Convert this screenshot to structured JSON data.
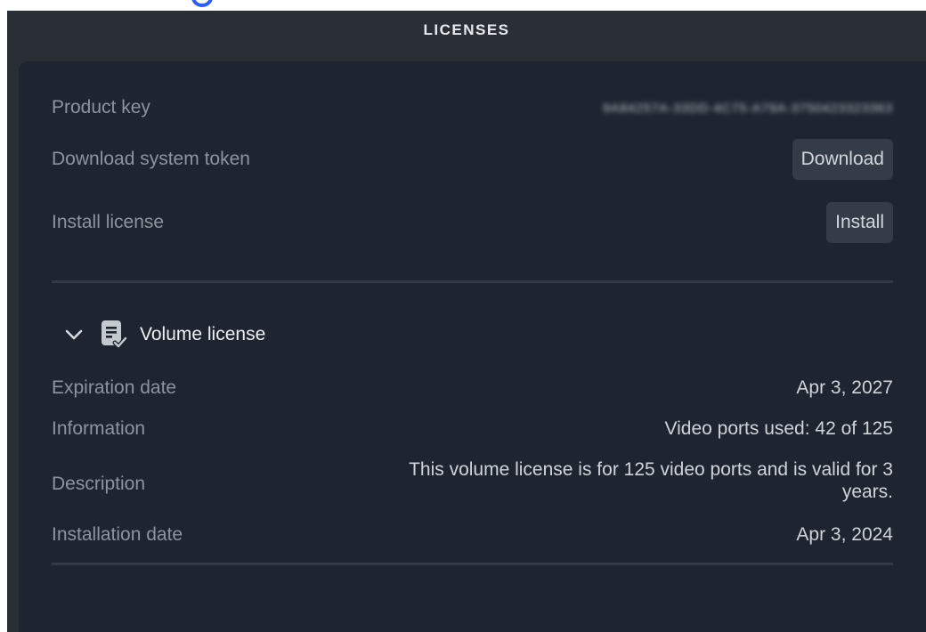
{
  "header": {
    "title": "LICENSES"
  },
  "product_key": {
    "label": "Product key",
    "value": "9A84257A-33DD-4C75-A79A-3750423323363"
  },
  "download_token": {
    "label": "Download system token",
    "button": "Download"
  },
  "install_license": {
    "label": "Install license",
    "button": "Install"
  },
  "volume_license": {
    "title": "Volume license",
    "expanded": true,
    "fields": {
      "expiration": {
        "label": "Expiration date",
        "value": "Apr 3, 2027"
      },
      "information": {
        "label": "Information",
        "value": "Video ports used: 42 of 125"
      },
      "description": {
        "label": "Description",
        "value_line1": "This volume license is for 125 video ports and is valid for 3",
        "value_line2": "years."
      },
      "installation": {
        "label": "Installation date",
        "value": "Apr 3, 2024"
      }
    }
  },
  "colors": {
    "background": "#2a2f36",
    "panel": "#1e2530",
    "button": "#343c47",
    "label_text": "#8c949e",
    "value_text": "#d0d4d9"
  },
  "icons": [
    "chevron-down-icon",
    "license-document-icon"
  ]
}
